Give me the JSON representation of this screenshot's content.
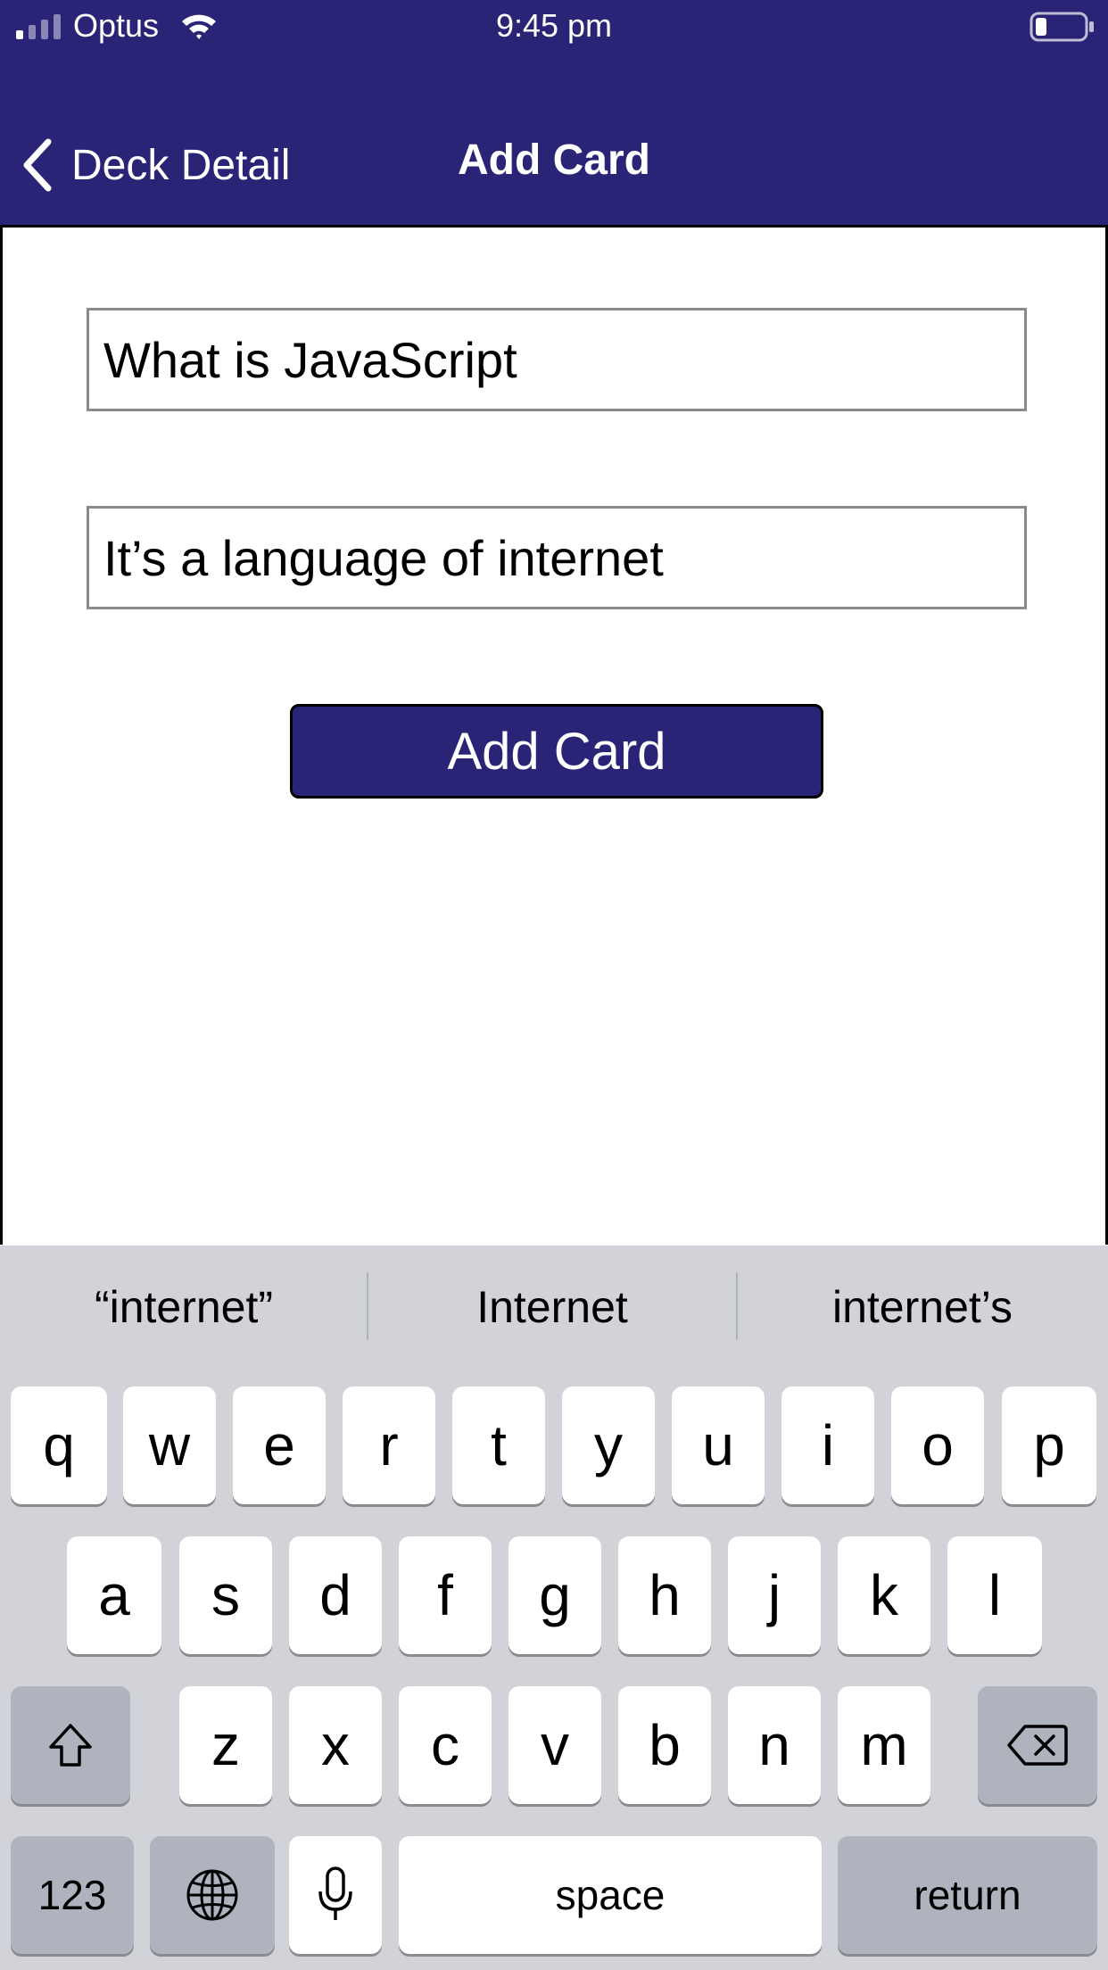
{
  "status_bar": {
    "carrier": "Optus",
    "time": "9:45 pm"
  },
  "nav": {
    "back_label": "Deck Detail",
    "title": "Add Card"
  },
  "form": {
    "question_value": "What is JavaScript",
    "answer_value": "It’s a language of internet",
    "submit_label": "Add Card"
  },
  "keyboard": {
    "suggestions": [
      "“internet”",
      "Internet",
      "internet’s"
    ],
    "row1": [
      "q",
      "w",
      "e",
      "r",
      "t",
      "y",
      "u",
      "i",
      "o",
      "p"
    ],
    "row2": [
      "a",
      "s",
      "d",
      "f",
      "g",
      "h",
      "j",
      "k",
      "l"
    ],
    "row3": [
      "z",
      "x",
      "c",
      "v",
      "b",
      "n",
      "m"
    ],
    "numbers_label": "123",
    "space_label": "space",
    "return_label": "return"
  },
  "colors": {
    "brand": "#2a2476",
    "keyboard_bg": "#d1d3d9",
    "key_dark": "#aeb3be"
  }
}
